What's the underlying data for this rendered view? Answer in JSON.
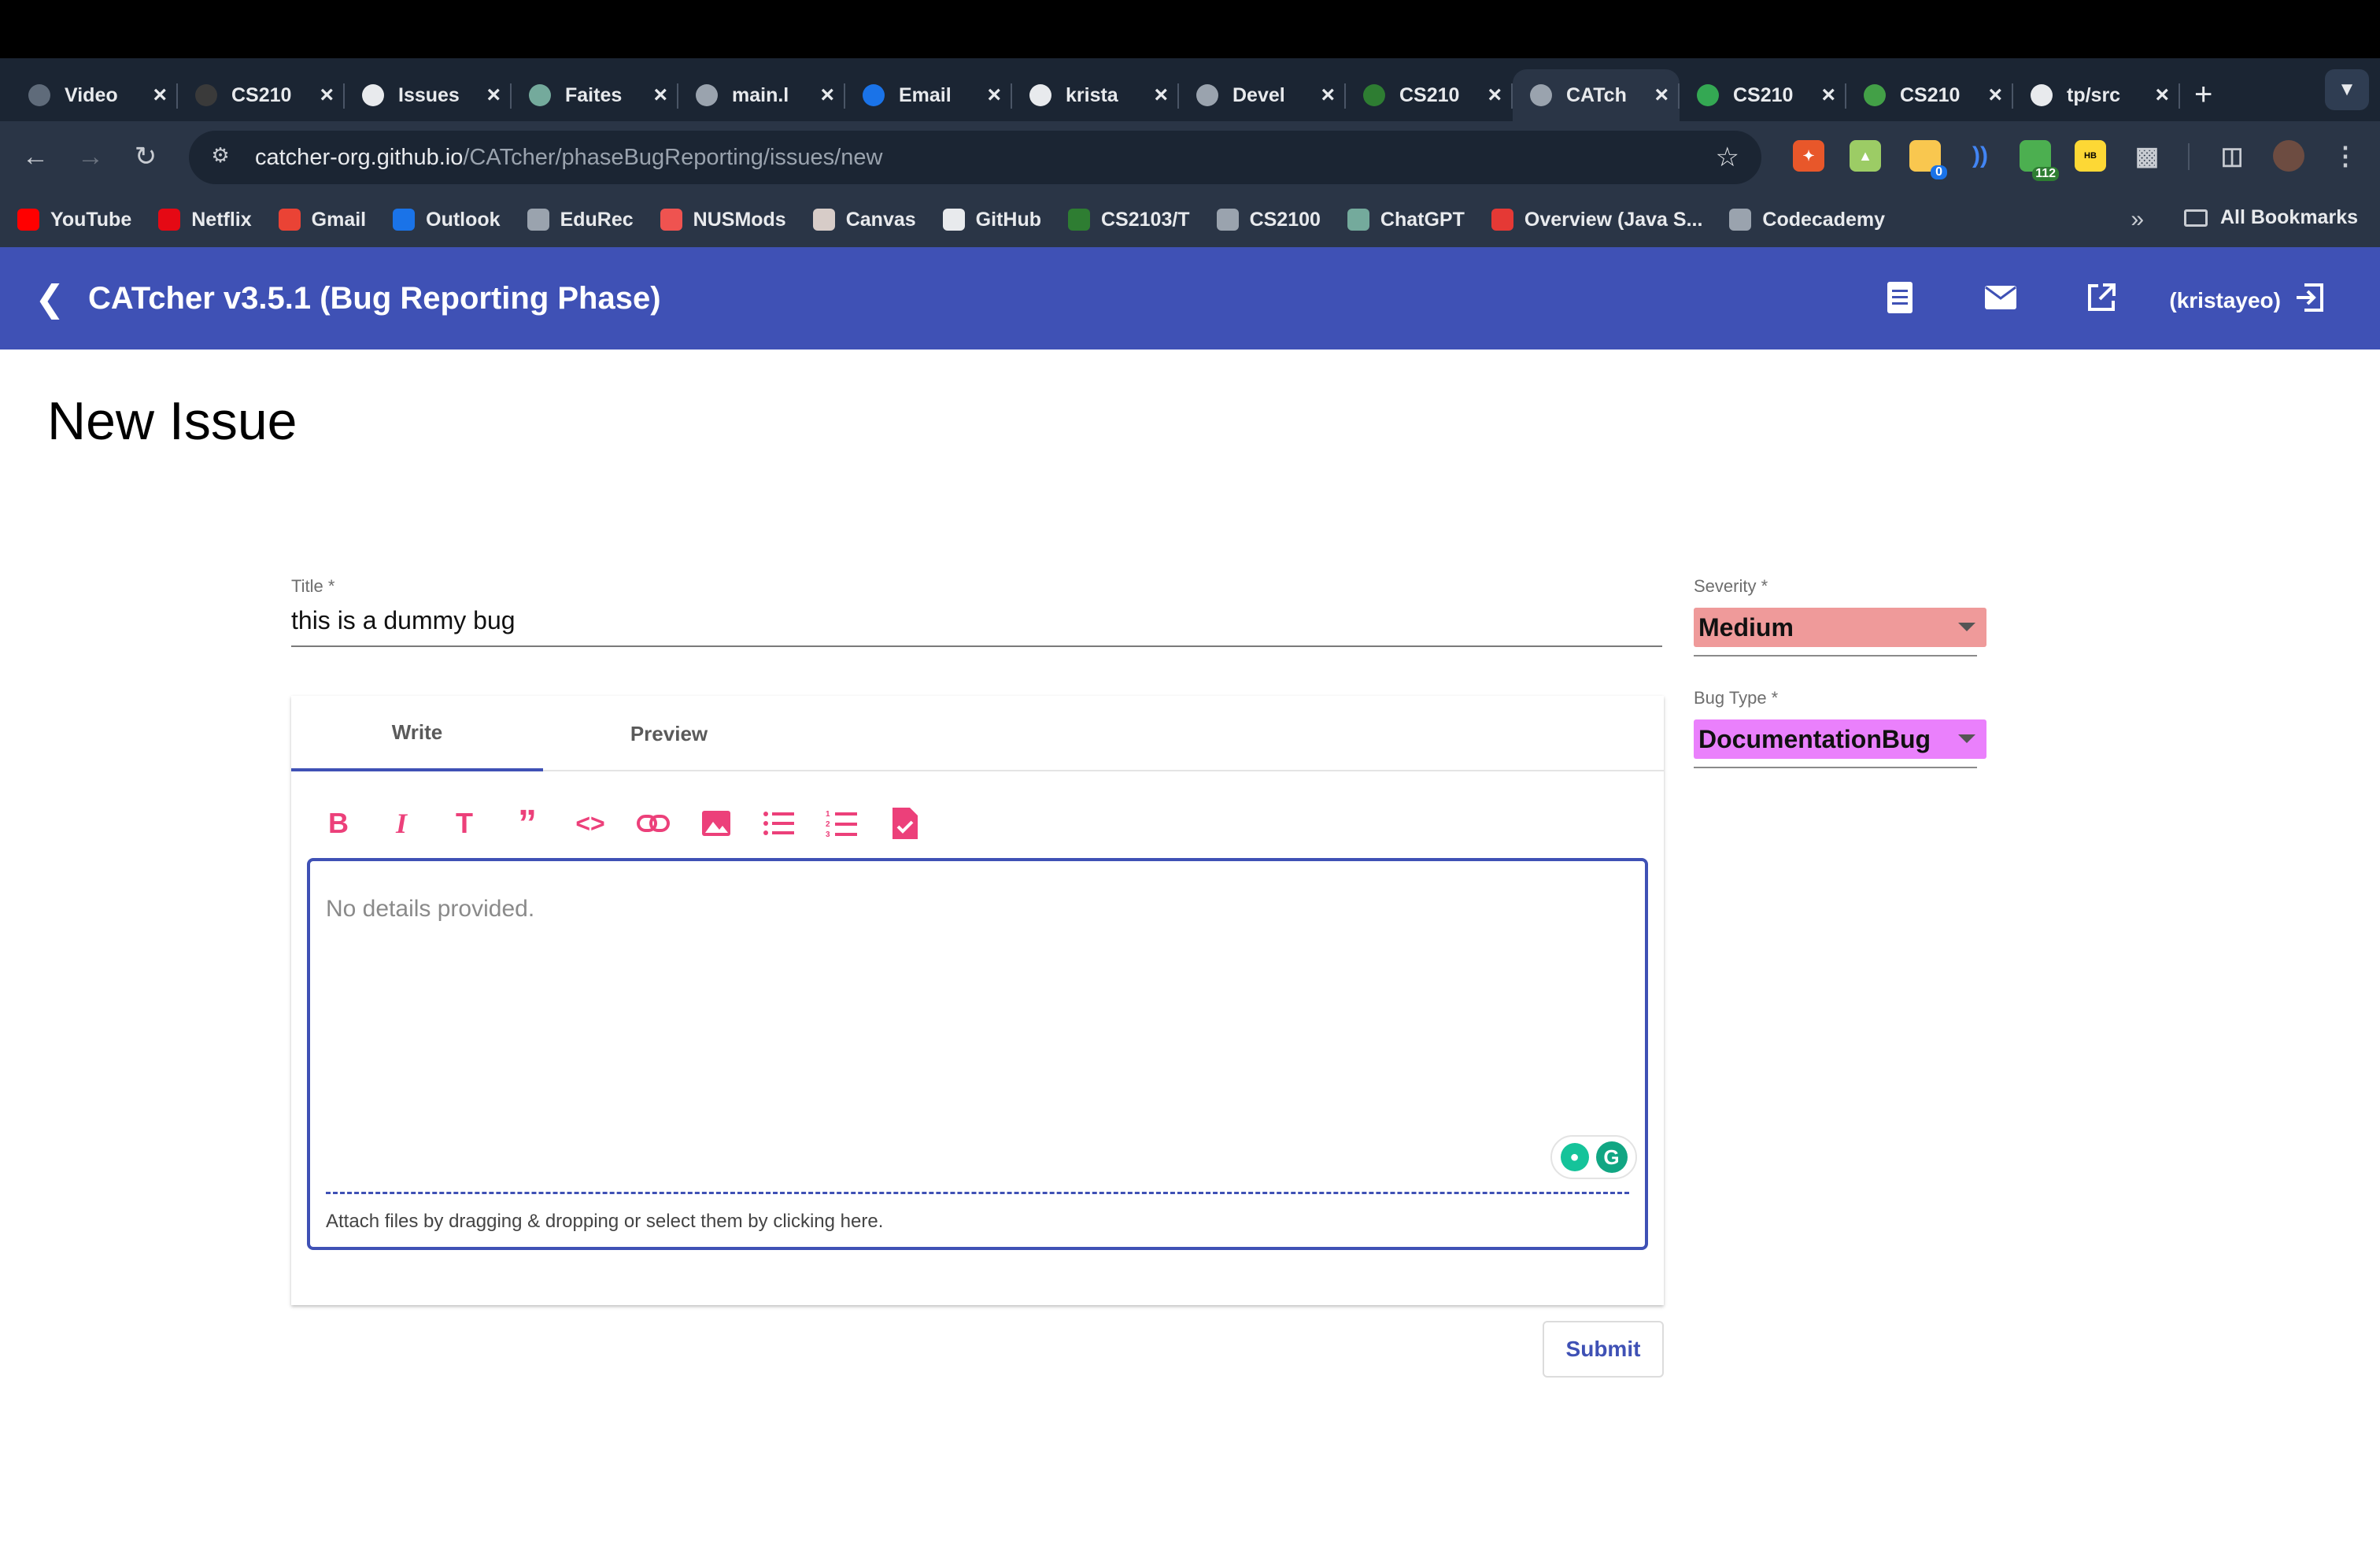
{
  "browser": {
    "tabs": [
      {
        "title": "Video",
        "icon": "video-icon",
        "color": "#5f6b7a"
      },
      {
        "title": "CS210",
        "icon": "terminal-icon",
        "color": "#3a3a3a"
      },
      {
        "title": "Issues",
        "icon": "github-icon",
        "color": "#e8eaed"
      },
      {
        "title": "Faites",
        "icon": "chatgpt-icon",
        "color": "#74aa9c"
      },
      {
        "title": "main.l",
        "icon": "globe-icon",
        "color": "#9aa3ae"
      },
      {
        "title": "Email",
        "icon": "outlook-icon",
        "color": "#1a73e8"
      },
      {
        "title": "krista",
        "icon": "github-icon",
        "color": "#e8eaed"
      },
      {
        "title": "Devel",
        "icon": "globe-icon",
        "color": "#9aa3ae"
      },
      {
        "title": "CS210",
        "icon": "graduation-cap-icon",
        "color": "#2e7d32"
      },
      {
        "title": "CATch",
        "icon": "catcher-icon",
        "color": "#9aa3ae"
      },
      {
        "title": "CS210",
        "icon": "sheets-icon",
        "color": "#34a853"
      },
      {
        "title": "CS210",
        "icon": "grid-icon",
        "color": "#43a047"
      },
      {
        "title": "tp/src",
        "icon": "github-icon",
        "color": "#e8eaed"
      }
    ],
    "active_tab_index": 9,
    "url_host": "catcher-org.github.io",
    "url_path": "/CATcher/phaseBugReporting/issues/new",
    "extension_badges": {
      "notes": "0",
      "counter": "112"
    },
    "bookmarks": [
      {
        "label": "YouTube",
        "icon": "youtube-icon",
        "color": "#ff0000"
      },
      {
        "label": "Netflix",
        "icon": "netflix-icon",
        "color": "#e50914"
      },
      {
        "label": "Gmail",
        "icon": "gmail-icon",
        "color": "#ea4335"
      },
      {
        "label": "Outlook",
        "icon": "outlook-icon",
        "color": "#1a73e8"
      },
      {
        "label": "EduRec",
        "icon": "globe-icon",
        "color": "#9aa3ae"
      },
      {
        "label": "NUSMods",
        "icon": "nusmods-icon",
        "color": "#ef5350"
      },
      {
        "label": "Canvas",
        "icon": "canvas-icon",
        "color": "#d7ccc8"
      },
      {
        "label": "GitHub",
        "icon": "github-icon",
        "color": "#e8eaed"
      },
      {
        "label": "CS2103/T",
        "icon": "graduation-cap-icon",
        "color": "#2e7d32"
      },
      {
        "label": "CS2100",
        "icon": "globe-icon",
        "color": "#9aa3ae"
      },
      {
        "label": "ChatGPT",
        "icon": "chatgpt-icon",
        "color": "#74aa9c"
      },
      {
        "label": "Overview (Java S...",
        "icon": "oracle-icon",
        "color": "#e53935"
      },
      {
        "label": "Codecademy",
        "icon": "folder-icon",
        "color": "#9aa3ae"
      }
    ],
    "all_bookmarks_label": "All Bookmarks"
  },
  "app": {
    "title": "CATcher v3.5.1  (Bug Reporting Phase)",
    "user": "(kristayeo)",
    "accent": "#3f51b5"
  },
  "page": {
    "heading": "New Issue",
    "title_label": "Title *",
    "title_value": "this is a dummy bug",
    "tabs": [
      "Write",
      "Preview"
    ],
    "editor_placeholder": "No details provided.",
    "attach_hint": "Attach files by dragging & dropping or select them by clicking here.",
    "submit_label": "Submit",
    "severity_label": "Severity *",
    "severity_value": "Medium",
    "severity_color": "#ef9a9a",
    "bug_type_label": "Bug Type *",
    "bug_type_value": "DocumentationBug",
    "bug_type_color": "#ea80fc",
    "toolbar_icons": [
      "bold-icon",
      "italic-icon",
      "heading-icon",
      "quote-icon",
      "code-icon",
      "link-icon",
      "image-icon",
      "bulleted-list-icon",
      "numbered-list-icon",
      "file-check-icon"
    ],
    "toolbar_color": "#ec407a"
  }
}
